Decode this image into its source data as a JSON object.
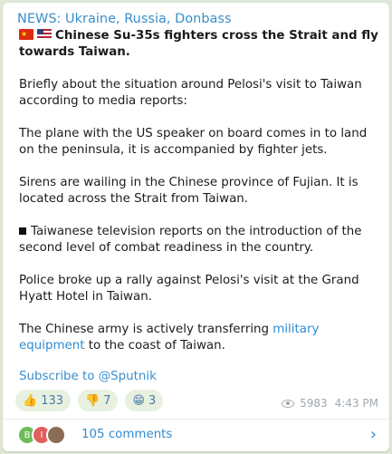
{
  "post": {
    "channel": "NEWS: Ukraine, Russia, Donbass",
    "headline": "Chinese Su-35s fighters cross the Strait and fly towards Taiwan.",
    "p1": "Briefly about the situation around Pelosi's visit to Taiwan according to media reports:",
    "p2": "The plane with the US speaker on board comes in to land on the peninsula, it is accompanied by fighter jets.",
    "p3": "Sirens are wailing in the Chinese province of Fujian. It is located across the Strait from Taiwan.",
    "p4": "Taiwanese television reports on the introduction of the second level of combat readiness in the country.",
    "p5": "Police broke up a rally against Pelosi's visit at the Grand Hyatt Hotel in Taiwan.",
    "p6_before": "The Chinese army is actively transferring ",
    "p6_link": "military equipment",
    "p6_after": " to the coast of Taiwan.",
    "subscribe": "Subscribe to @Sputnik"
  },
  "reactions": [
    {
      "icon": "thumbs-up-icon",
      "emoji": "👍",
      "count": "133"
    },
    {
      "icon": "thumbs-down-icon",
      "emoji": "👎",
      "count": "7"
    },
    {
      "icon": "grin-icon",
      "emoji": "😁",
      "count": "3"
    }
  ],
  "meta": {
    "views": "5983",
    "time": "4:43 PM"
  },
  "comments": {
    "label": "105 comments",
    "avatars": [
      "B",
      "I",
      ""
    ]
  },
  "colors": {
    "background": "#dfe8d6",
    "link": "#2f8bd0",
    "channel": "#3a8ecb",
    "bubble": "#ffffff"
  }
}
